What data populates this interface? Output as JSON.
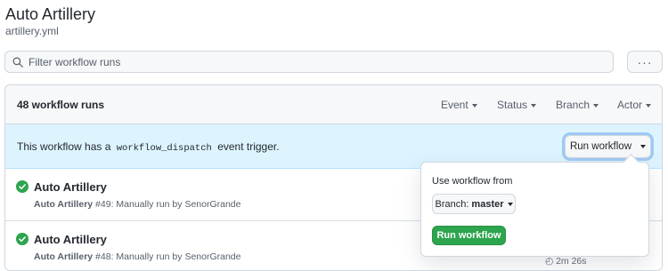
{
  "header": {
    "title": "Auto Artillery",
    "file": "artillery.yml"
  },
  "search": {
    "placeholder": "Filter workflow runs",
    "value": ""
  },
  "more": {
    "label": "···"
  },
  "runs": {
    "count_label": "48 workflow runs",
    "filters": [
      "Event",
      "Status",
      "Branch",
      "Actor"
    ]
  },
  "banner": {
    "prefix": "This workflow has a",
    "code": "workflow_dispatch",
    "suffix": "event trigger.",
    "button": "Run workflow"
  },
  "run_list": [
    {
      "title": "Auto Artillery",
      "workflow": "Auto Artillery",
      "detail": "#49: Manually run by SenorGrande",
      "duration": ""
    },
    {
      "title": "Auto Artillery",
      "workflow": "Auto Artillery",
      "detail": "#48: Manually run by SenorGrande",
      "duration": "2m 26s"
    }
  ],
  "popover": {
    "label": "Use workflow from",
    "branch_prefix": "Branch:",
    "branch_value": "master",
    "submit": "Run workflow"
  },
  "colors": {
    "success": "#2da44e",
    "banner_bg": "#ddf4ff",
    "primary_button": "#2da44e"
  },
  "icons": {
    "search": "search-icon",
    "success": "check-circle-icon",
    "more": "kebab-horizontal-icon"
  }
}
